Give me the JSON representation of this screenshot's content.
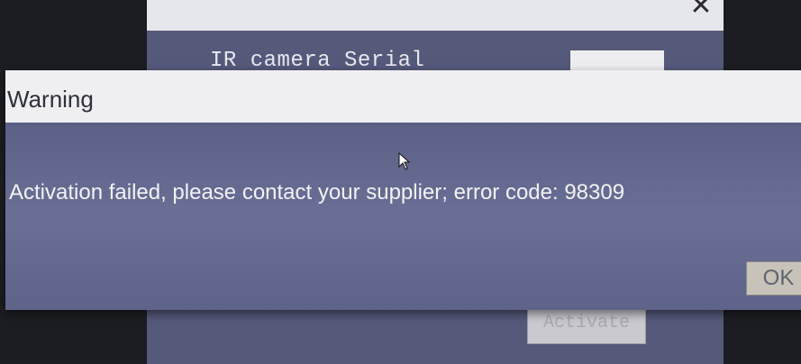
{
  "background_dialog": {
    "close_glyph": "✕",
    "serial_label": "IR camera Serial",
    "serial_value": "",
    "activate_label": "Activate"
  },
  "warning_dialog": {
    "title": "Warning",
    "message": "Activation failed, please contact your supplier; error code: 98309",
    "ok_label": "OK"
  },
  "cursor": {
    "icon": "mouse-pointer-icon"
  }
}
